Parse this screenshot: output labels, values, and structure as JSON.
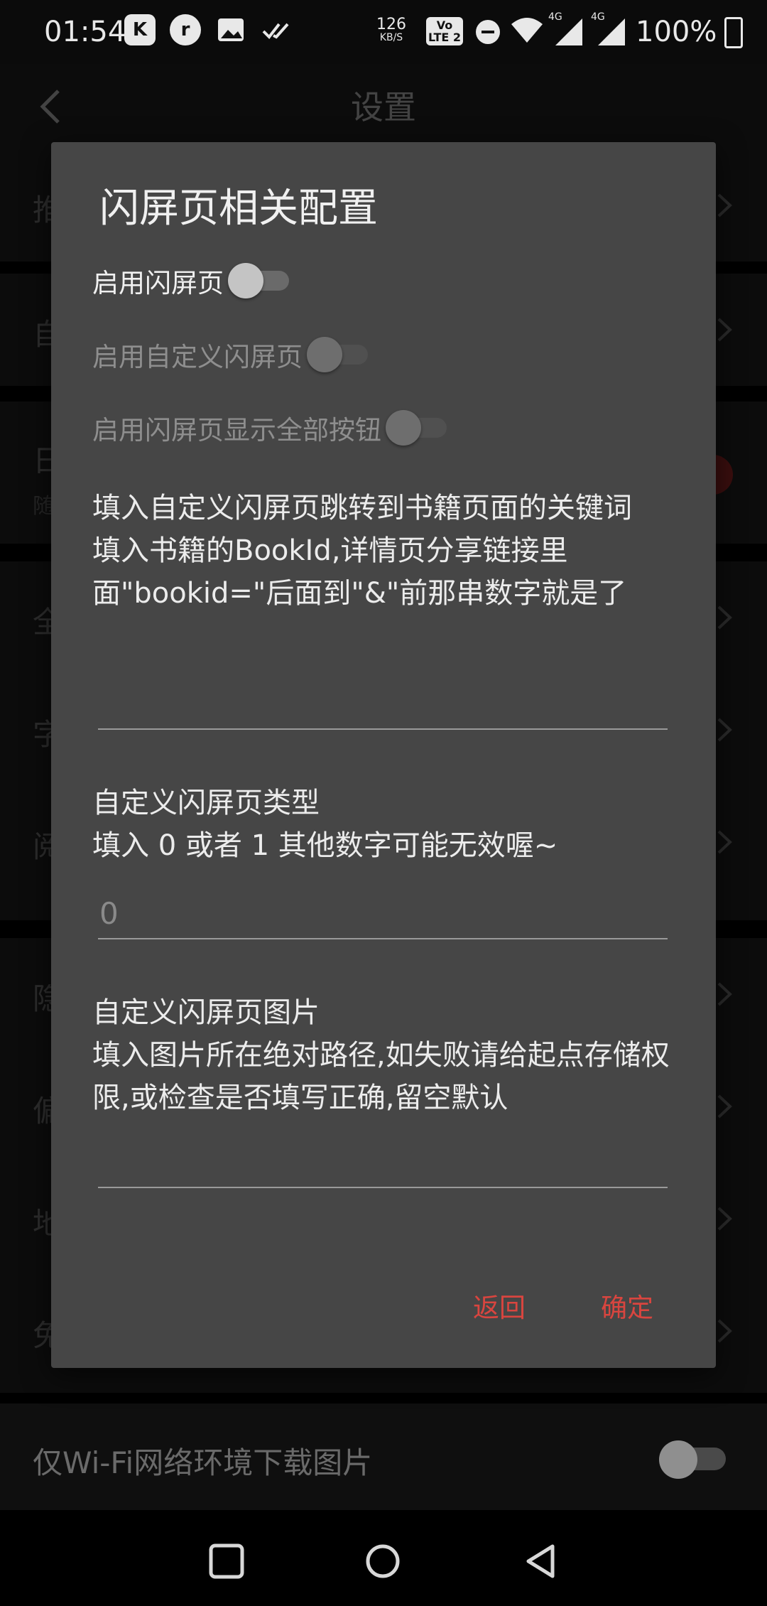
{
  "status_bar": {
    "time": "01:54",
    "net_speed_value": "126",
    "net_speed_unit": "KB/S",
    "volte_top": "Vo",
    "volte_bottom": "LTE 2",
    "signal_1_label": "4G",
    "signal_2_label": "4G",
    "battery": "100%",
    "icons_left": [
      "keymagic-icon",
      "app-icon",
      "image-icon",
      "doublecheck-icon"
    ]
  },
  "page": {
    "title": "设置",
    "back_icon": "chevron-left-icon",
    "rows_partial": [
      "推",
      "自",
      "日",
      "随",
      "全",
      "字",
      "阅",
      "隐",
      "偏",
      "地",
      "免"
    ],
    "wifi_row_label": "仅Wi-Fi网络环境下载图片",
    "wifi_toggle_on": false
  },
  "dialog": {
    "title": "闪屏页相关配置",
    "switches": [
      {
        "label": "启用闪屏页",
        "checked": false,
        "enabled": true
      },
      {
        "label": "启用自定义闪屏页",
        "checked": false,
        "enabled": false
      },
      {
        "label": "启用闪屏页显示全部按钮",
        "checked": false,
        "enabled": false
      }
    ],
    "bookid_desc": "填入自定义闪屏页跳转到书籍页面的关键词\n填入书籍的BookId,详情页分享链接里面\"bookid=\"后面到\"&\"前那串数字就是了",
    "bookid_value": "",
    "type_desc": "自定义闪屏页类型\n填入 0 或者 1 其他数字可能无效喔~",
    "type_placeholder": "0",
    "image_desc": "自定义闪屏页图片\n填入图片所在绝对路径,如失败请给起点存储权限,或检查是否填写正确,留空默认",
    "image_value": "",
    "cancel_label": "返回",
    "confirm_label": "确定"
  },
  "colors": {
    "accent_red": "#d9453f",
    "dialog_bg": "#464646"
  }
}
